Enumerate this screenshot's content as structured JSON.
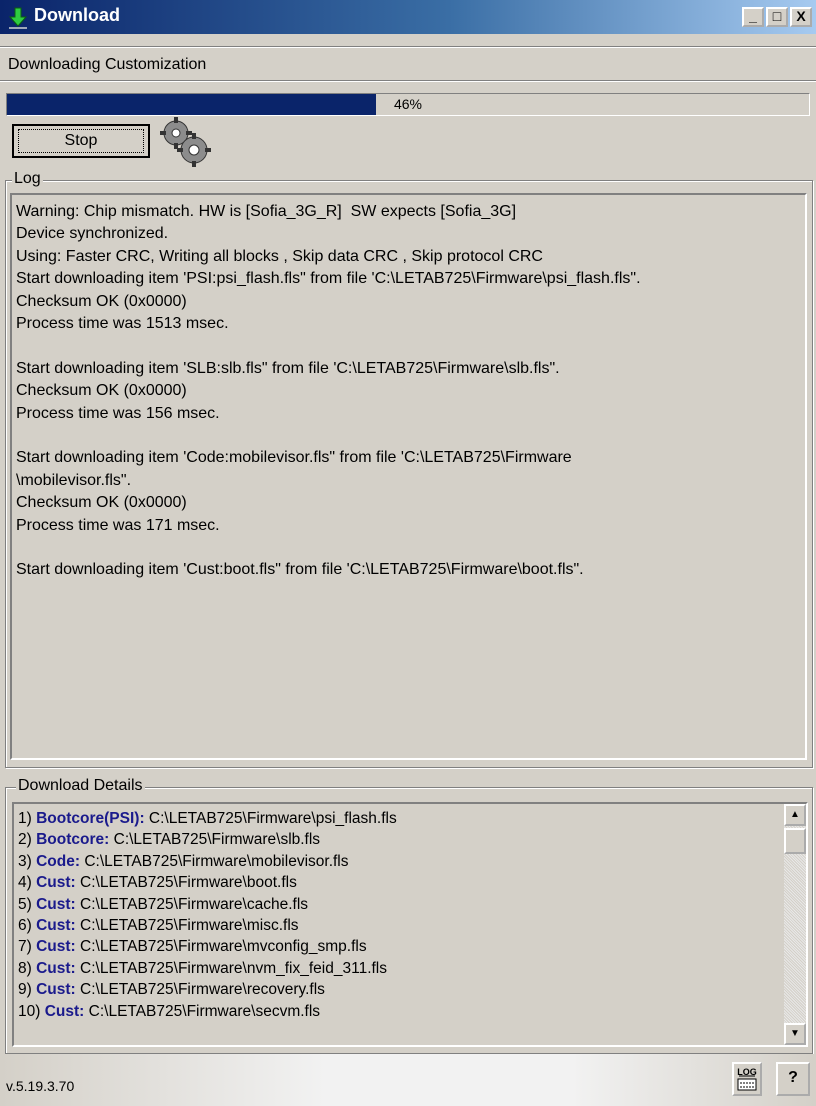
{
  "window": {
    "title": "Download",
    "controls": {
      "minimize": "_",
      "maximize": "□",
      "close": "X"
    }
  },
  "status": {
    "text": "Downloading Customization",
    "progress_percent": 46,
    "progress_label": "46%"
  },
  "toolbar": {
    "stop_label": "Stop",
    "gears_icon": "gears-icon"
  },
  "log": {
    "group_label": "Log",
    "lines": [
      "Warning: Chip mismatch. HW is [Sofia_3G_R]  SW expects [Sofia_3G]",
      "Device synchronized.",
      "Using: Faster CRC, Writing all blocks , Skip data CRC , Skip protocol CRC",
      "Start downloading item 'PSI:psi_flash.fls\" from file 'C:\\LETAB725\\Firmware\\psi_flash.fls\".",
      "Checksum OK (0x0000)",
      "Process time was 1513 msec.",
      "",
      "Start downloading item 'SLB:slb.fls\" from file 'C:\\LETAB725\\Firmware\\slb.fls\".",
      "Checksum OK (0x0000)",
      "Process time was 156 msec.",
      "",
      "Start downloading item 'Code:mobilevisor.fls\" from file 'C:\\LETAB725\\Firmware",
      "\\mobilevisor.fls\".",
      "Checksum OK (0x0000)",
      "Process time was 171 msec.",
      "",
      "Start downloading item 'Cust:boot.fls\" from file 'C:\\LETAB725\\Firmware\\boot.fls\"."
    ]
  },
  "details": {
    "group_label": "Download Details",
    "items": [
      {
        "index": "1)",
        "type": "Bootcore(PSI):",
        "path": "C:\\LETAB725\\Firmware\\psi_flash.fls"
      },
      {
        "index": "2)",
        "type": "Bootcore:",
        "path": "C:\\LETAB725\\Firmware\\slb.fls"
      },
      {
        "index": "3)",
        "type": "Code:",
        "path": "C:\\LETAB725\\Firmware\\mobilevisor.fls"
      },
      {
        "index": "4)",
        "type": "Cust:",
        "path": "C:\\LETAB725\\Firmware\\boot.fls"
      },
      {
        "index": "5)",
        "type": "Cust:",
        "path": "C:\\LETAB725\\Firmware\\cache.fls"
      },
      {
        "index": "6)",
        "type": "Cust:",
        "path": "C:\\LETAB725\\Firmware\\misc.fls"
      },
      {
        "index": "7)",
        "type": "Cust:",
        "path": "C:\\LETAB725\\Firmware\\mvconfig_smp.fls"
      },
      {
        "index": "8)",
        "type": "Cust:",
        "path": "C:\\LETAB725\\Firmware\\nvm_fix_feid_311.fls"
      },
      {
        "index": "9)",
        "type": "Cust:",
        "path": "C:\\LETAB725\\Firmware\\recovery.fls"
      },
      {
        "index": "10)",
        "type": "Cust:",
        "path": "C:\\LETAB725\\Firmware\\secvm.fls"
      }
    ]
  },
  "footer": {
    "version": "v.5.19.3.70",
    "log_button": "LOG",
    "help_button": "?"
  },
  "colors": {
    "titlebar": "#0a246a",
    "progress_fill": "#0a246a",
    "detail_type": "#1a1a8c",
    "face": "#d4d0c8"
  }
}
